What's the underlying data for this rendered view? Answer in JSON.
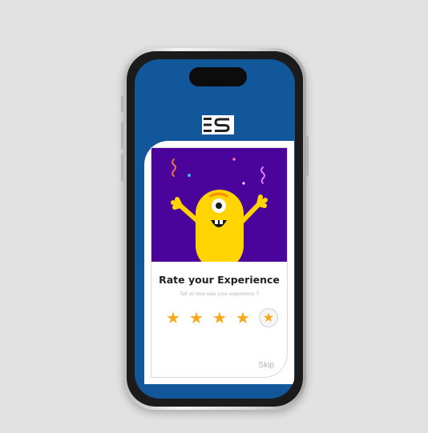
{
  "rating_card": {
    "title": "Rate your Experience",
    "subtitle": "Tell us how was your experience ?",
    "skip_label": "Skip",
    "rating": {
      "value": 4,
      "max": 5
    },
    "star_glyph": "★",
    "star_color": "#f6a817",
    "hero_background": "#4a049c",
    "mascot_color": "#ffd400"
  },
  "app": {
    "logo_icon": "es-logo-icon",
    "screen_background": "#11579a"
  }
}
